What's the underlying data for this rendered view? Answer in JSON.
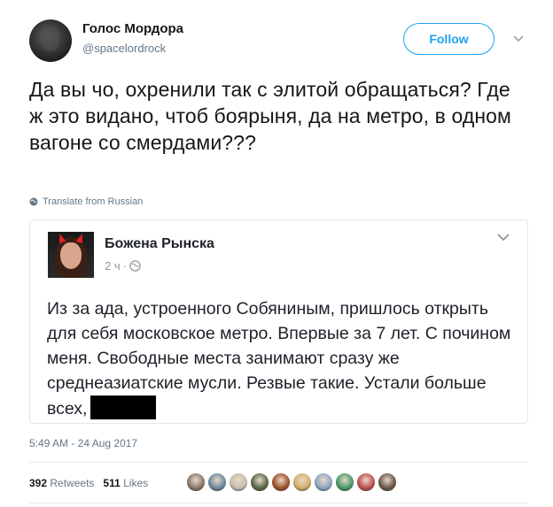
{
  "author": {
    "name": "Голос Мордора",
    "handle": "@spacelordrock"
  },
  "follow_label": "Follow",
  "tweet_text": "Да вы чо, охренили так с элитой обращаться? Где ж это видано, чтоб боярыня, да на метро, в одном вагоне со смердами???",
  "translate_label": "Translate from Russian",
  "quoted_post": {
    "name": "Божена Рынска",
    "time": "2 ч",
    "dot": "·",
    "text": "Из за ада, устроенного Собяниным, пришлось открыть для себя московское метро. Впервые за 7 лет. С почином меня. Свободные места занимают сразу же среднеазиатские мусли. Резвые такие. Устали больше всех,"
  },
  "timestamp": "5:49 AM - 24 Aug 2017",
  "stats": {
    "retweets_count": "392",
    "retweets_label": "Retweets",
    "likes_count": "511",
    "likes_label": "Likes"
  },
  "liker_colors": [
    "#8a7a6a",
    "#6f8aa0",
    "#c9c0b0",
    "#5a6a4a",
    "#a0522d",
    "#d4b06a",
    "#8fa8c8",
    "#4a9a6a",
    "#c05050",
    "#6a5a4a"
  ],
  "icons": {
    "caret": "chevron-down-icon",
    "globe": "globe-icon",
    "fb_globe": "globe-icon",
    "fb_chevron": "chevron-down-icon"
  }
}
